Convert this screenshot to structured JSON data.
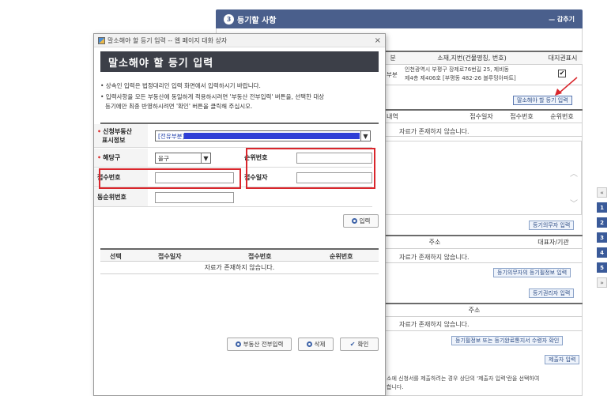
{
  "background": {
    "section_number": "3",
    "section_title": "등기할 사항",
    "collapse_label": "— 감추기",
    "table": {
      "col_division_partial": "분",
      "col_address": "소재,지번(건물명칭, 번호)",
      "col_land_right": "대지권표시",
      "row_division": "부분",
      "row_address_line1": "인천광역시 부평구 장제로76번길 25, 제비동",
      "row_address_line2": "제4층 제406호 [부평동 482-26 블루밍아파트]",
      "row_checked": "✔"
    },
    "cancel_register_button": "말소해야 할 등기 입력",
    "list1": {
      "col_content_partial": "내역",
      "col_receipt_date": "접수일자",
      "col_receipt_no": "접수번호",
      "col_rank_no": "순위번호",
      "empty_text": "자료가 존재하지 않습니다."
    },
    "obligor_input_button": "등기의무자 입력",
    "list2": {
      "col_address": "주소",
      "col_representative": "대표자/기관",
      "empty_text": "자료가 존재하지 않습니다."
    },
    "obligor_info_button": "등기의무자의 등기필정보 입력",
    "holder_input_button": "등기권리자 입력",
    "list3": {
      "col_address": "주소",
      "empty_text": "자료가 존재하지 않습니다."
    },
    "confirm_recipient_button": "등기필정보 또는 등기완료통지서 수령자 확인",
    "submitter_input_button": "제출자 입력",
    "footer_note_line1": "소에 신청서를 제출하려는 경우 상단의 '제출자 입력'란을 선택하여",
    "footer_note_line2": "합니다.",
    "side_nav": {
      "up": "«",
      "items": [
        "1",
        "2",
        "3",
        "4",
        "5"
      ],
      "down": "»"
    }
  },
  "dialog": {
    "window_title": "말소해야 할 등기 입력 -- 웹 페이지 대화 상자",
    "close_label": "×",
    "banner_title": "말소해야 할 등기 입력",
    "notice_1": "• 상속인 입력은 법정대리인 입력 화면에서 입력하시기 바랍니다.",
    "notice_2a": "• 입력사항을 모든 부동산에 동일하게 적용하시려면 '부동산 전부입력' 버튼을, 선택한 대상",
    "notice_2b": "등기에만 최종 반영하시려면 '확인' 버튼을 클릭해 주십시오.",
    "form": {
      "property_label_1": "신청부동산",
      "property_label_2": "표시정보",
      "property_value": "[전유부분]",
      "required_mark": "•",
      "section_label": "해당구",
      "section_value": "을구",
      "rank_label": "순위번호",
      "rank_value": "",
      "receipt_no_label": "접수번호",
      "receipt_no_value": "",
      "receipt_date_label": "접수일자",
      "receipt_date_value": "",
      "same_rank_label": "동순위번호",
      "same_rank_value": ""
    },
    "input_button": "입력",
    "result_table": {
      "col_select": "선택",
      "col_receipt_date": "접수일자",
      "col_receipt_no": "접수번호",
      "col_rank_no": "순위번호",
      "empty_text": "자료가 존재하지 않습니다."
    },
    "buttons": {
      "all_property": "부동산 전부입력",
      "delete": "삭제",
      "confirm": "확인"
    }
  },
  "colors": {
    "header_blue": "#4a5f8c",
    "banner_dark": "#3c3f48",
    "highlight_red": "#d9262c",
    "accent_blue": "#3c62a8"
  }
}
